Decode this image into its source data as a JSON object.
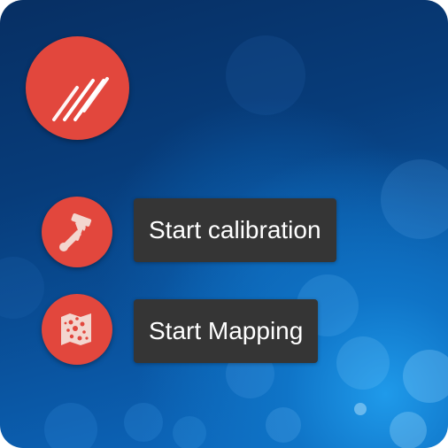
{
  "menu": {
    "main_button_icon": "hatch-lines-icon",
    "accent_color": "#e2473d",
    "label_background": "#353535",
    "items": [
      {
        "label": "Start calibration",
        "icon": "calibration-tools-icon"
      },
      {
        "label": "Start Mapping",
        "icon": "map-icon"
      }
    ]
  }
}
